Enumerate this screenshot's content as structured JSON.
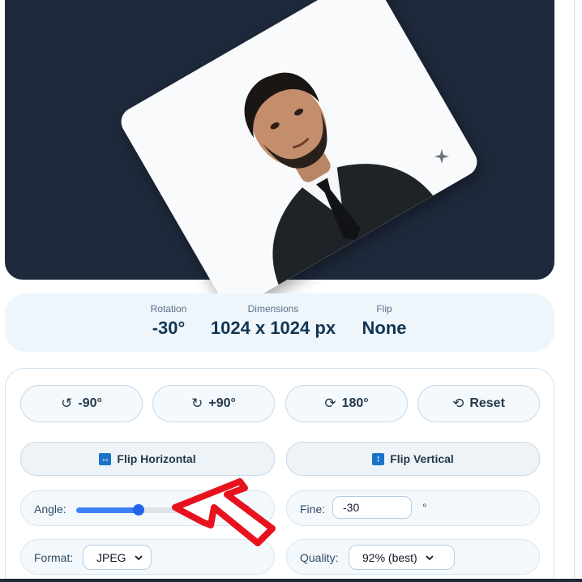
{
  "preview": {
    "accent": "#1e293b",
    "rotation_degrees": -30
  },
  "stats": {
    "rotation_label": "Rotation",
    "rotation_value": "-30°",
    "dimensions_label": "Dimensions",
    "dimensions_value": "1024 x 1024 px",
    "flip_label": "Flip",
    "flip_value": "None"
  },
  "buttons": {
    "rotate_left": {
      "icon": "rotate-ccw-icon",
      "glyph": "↺",
      "label": "-90°"
    },
    "rotate_right": {
      "icon": "rotate-cw-icon",
      "glyph": "↻",
      "label": "+90°"
    },
    "rotate_180": {
      "icon": "rotate-180-icon",
      "glyph": "⟳",
      "label": "180°"
    },
    "reset": {
      "icon": "reset-icon",
      "glyph": "⟲",
      "label": "Reset"
    },
    "flip_horizontal": {
      "icon": "flip-horizontal-icon",
      "glyph": "↔",
      "label": "Flip Horizontal"
    },
    "flip_vertical": {
      "icon": "flip-vertical-icon",
      "glyph": "↕",
      "label": "Flip Vertical"
    }
  },
  "angle": {
    "label": "Angle:",
    "value": "-30",
    "min": -180,
    "max": 180,
    "level": -30
  },
  "fine": {
    "label": "Fine:",
    "value": "-30",
    "unit": "°"
  },
  "format": {
    "label": "Format:",
    "selected": "JPEG"
  },
  "quality": {
    "label": "Quality:",
    "selected": "92% (best)"
  },
  "colors": {
    "accent_blue": "#2563eb",
    "annotation_red": "#e8121f",
    "dark_panel": "#1e293b"
  }
}
